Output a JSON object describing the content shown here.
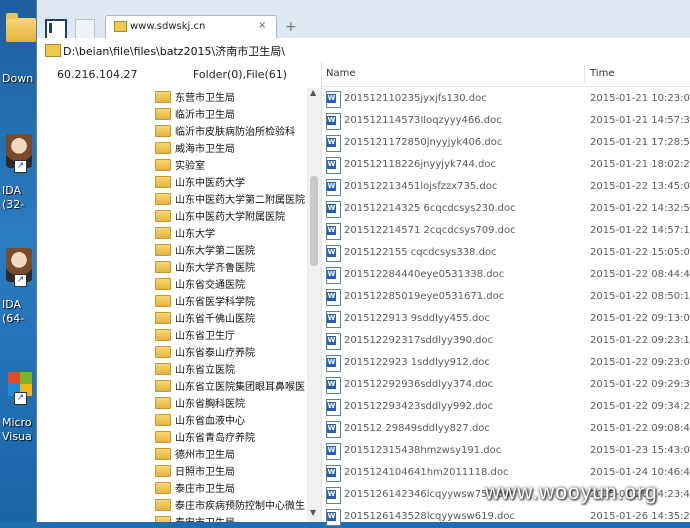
{
  "desktop": {
    "icons": [
      {
        "label": "Down",
        "type": "folder-icon"
      },
      {
        "label": "IDA",
        "label2": "(32-",
        "type": "ida-icon"
      },
      {
        "label": "IDA",
        "label2": "(64-",
        "type": "ida-icon"
      },
      {
        "label": "Micro",
        "label2": "Visua",
        "type": "visual-studio-icon"
      }
    ]
  },
  "browser": {
    "tab_title": "www.sdwskj.cn",
    "tab_close": "×",
    "new_tab": "+",
    "address": "D:\\beian\\file\\files\\batz2015\\济南市卫生局\\"
  },
  "info": {
    "ip": "60.216.104.27",
    "folder_count": "Folder(0),File(61)"
  },
  "tree": {
    "items": [
      "东营市卫生局",
      "临沂市卫生局",
      "临沂市皮肤病防治所检验科",
      "威海市卫生局",
      "实验室",
      "山东中医药大学",
      "山东中医药大学第二附属医院",
      "山东中医药大学附属医院",
      "山东大学",
      "山东大学第二医院",
      "山东大学齐鲁医院",
      "山东省交通医院",
      "山东省医学科学院",
      "山东省千佛山医院",
      "山东省卫生厅",
      "山东省泰山疗养院",
      "山东省立医院",
      "山东省立医院集团眼耳鼻喉医",
      "山东省胸科医院",
      "山东省血液中心",
      "山东省青岛疗养院",
      "德州市卫生局",
      "日照市卫生局",
      "泰庄市卫生局",
      "泰庄市疾病预防控制中心微生",
      "泰安市卫生局"
    ]
  },
  "files": {
    "col_name": "Name",
    "col_time": "Time",
    "rows": [
      {
        "name": "201512110235jyxjfs130.doc",
        "time": "2015-01-21 10:23:05"
      },
      {
        "name": "201512114573Iloqzyyy466.doc",
        "time": "2015-01-21 14:57:33"
      },
      {
        "name": "2015121172850jnyyjyk406.doc",
        "time": "2015-01-21 17:28:50"
      },
      {
        "name": "201512118226jnyyjyk744.doc",
        "time": "2015-01-21 18:02:26"
      },
      {
        "name": "201512213451lojsfzzx735.doc",
        "time": "2015-01-22 13:45:01"
      },
      {
        "name": "201512214325 6cqcdcsys230.doc",
        "time": "2015-01-22 14:32:56"
      },
      {
        "name": "201512214571 2cqcdcsys709.doc",
        "time": "2015-01-22 14:57:12"
      },
      {
        "name": "2015122155 cqcdcsys338.doc",
        "time": "2015-01-22 15:05:05"
      },
      {
        "name": "201512284440eye0531338.doc",
        "time": "2015-01-22 08:44:40"
      },
      {
        "name": "201512285019eye0531671.doc",
        "time": "2015-01-22 08:50:19"
      },
      {
        "name": "2015122913 9sddlyy455.doc",
        "time": "2015-01-22 09:13:09"
      },
      {
        "name": "201512292317sddlyy390.doc",
        "time": "2015-01-22 09:23:17"
      },
      {
        "name": "2015122923 1sddlyy912.doc",
        "time": "2015-01-22 09:23:01"
      },
      {
        "name": "201512292936sddlyy374.doc",
        "time": "2015-01-22 09:29:36"
      },
      {
        "name": "201512293423sddlyy992.doc",
        "time": "2015-01-22 09:34:23"
      },
      {
        "name": "201512 29849sddlyy827.doc",
        "time": "2015-01-22 09:08:49"
      },
      {
        "name": "201512315438hmzwsy191.doc",
        "time": "2015-01-23 15:43:08"
      },
      {
        "name": "2015124104641hm2011118.doc",
        "time": "2015-01-24 10:46:41"
      },
      {
        "name": "2015126142346lcqyywsw757.doc",
        "time": "2015-01-26 14:23:46"
      },
      {
        "name": "2015126143528lcqyywsw619.doc",
        "time": "2015-01-26 14:35:28"
      }
    ]
  },
  "watermark": "www.wooyun.org"
}
